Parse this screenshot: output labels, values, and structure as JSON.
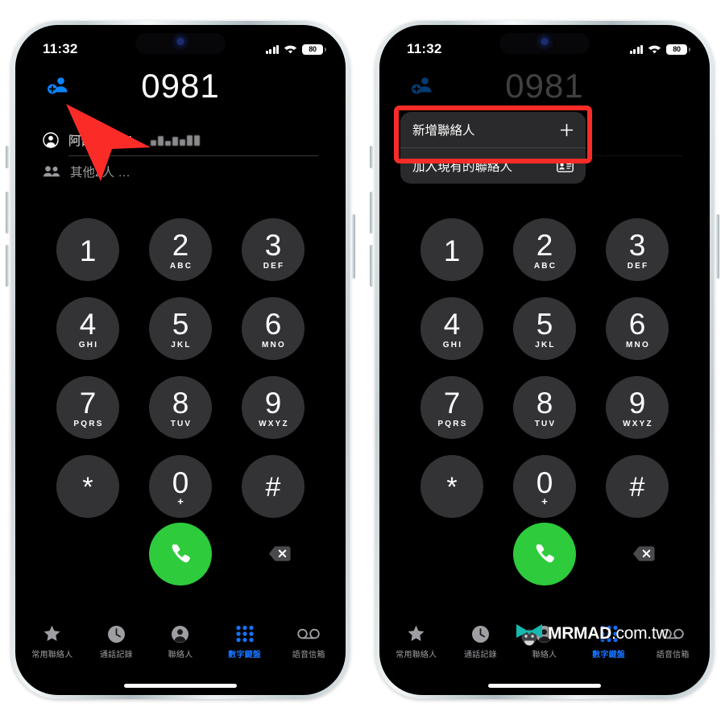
{
  "status_bar": {
    "time": "11:32",
    "battery_level": "80",
    "signal_icon": "cellular-bars-icon",
    "wifi_icon": "wifi-icon",
    "battery_icon": "battery-icon"
  },
  "dialer": {
    "entered_number": "0981",
    "add_contact_icon": "add-person-icon",
    "suggestion": {
      "icon": "contact-person-icon",
      "label": "阿嵌、0981-",
      "redacted": true
    },
    "others": {
      "icon": "people-group-icon",
      "label": "其他2人 …"
    },
    "keys": [
      {
        "digit": "1",
        "letters": ""
      },
      {
        "digit": "2",
        "letters": "ABC"
      },
      {
        "digit": "3",
        "letters": "DEF"
      },
      {
        "digit": "4",
        "letters": "GHI"
      },
      {
        "digit": "5",
        "letters": "JKL"
      },
      {
        "digit": "6",
        "letters": "MNO"
      },
      {
        "digit": "7",
        "letters": "PQRS"
      },
      {
        "digit": "8",
        "letters": "TUV"
      },
      {
        "digit": "9",
        "letters": "WXYZ"
      },
      {
        "digit": "*",
        "letters": ""
      },
      {
        "digit": "0",
        "letters": "+"
      },
      {
        "digit": "#",
        "letters": ""
      }
    ],
    "call_button_icon": "phone-handset-icon",
    "call_button_color": "#2ECB3C",
    "delete_button_icon": "backspace-delete-icon"
  },
  "tab_bar": {
    "active_color": "#1473FF",
    "items": [
      {
        "label": "常用聯絡人",
        "icon": "star-icon",
        "active": false
      },
      {
        "label": "通話記錄",
        "icon": "clock-icon",
        "active": false
      },
      {
        "label": "聯絡人",
        "icon": "person-circle-icon",
        "active": false
      },
      {
        "label": "數字鍵盤",
        "icon": "keypad-dots-icon",
        "active": true
      },
      {
        "label": "語音信箱",
        "icon": "voicemail-icon",
        "active": false
      }
    ]
  },
  "popup_menu": {
    "highlight_color": "#FB2C28",
    "items": [
      {
        "label": "新增聯絡人",
        "icon": "plus-icon"
      },
      {
        "label": "加入現有的聯絡人",
        "icon": "contact-card-icon"
      }
    ]
  },
  "annotation": {
    "arrow_icon": "red-pointer-arrow",
    "arrow_color": "#FB2C28"
  },
  "watermark": {
    "logo_icon": "mrmad-cat-logo",
    "brand": "MRMAD",
    "domain": ".com.tw"
  }
}
